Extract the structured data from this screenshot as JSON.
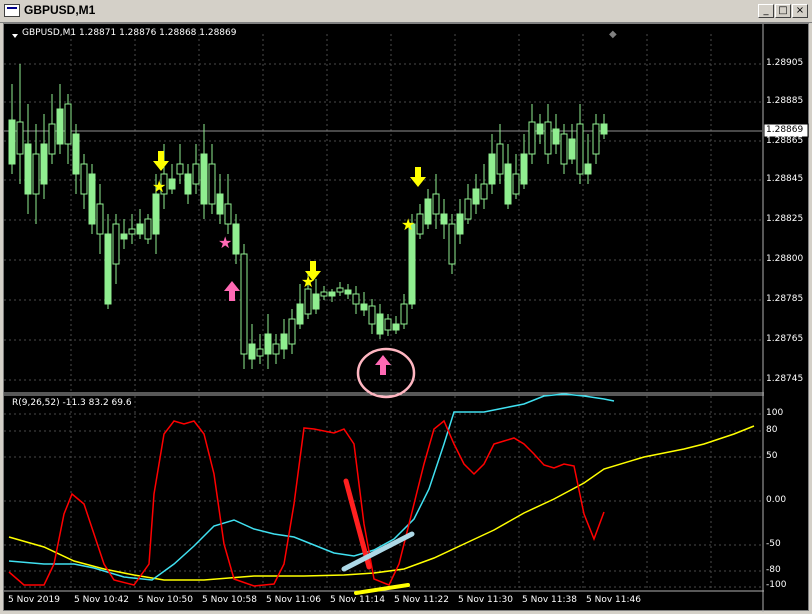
{
  "window": {
    "title": "GBPUSD,M1",
    "buttons": [
      "_",
      "□",
      "×"
    ]
  },
  "chart": {
    "symbol_header": "GBPUSD,M1  1.28871 1.28876 1.28868 1.28869",
    "current_price": "1.28869",
    "price_labels": [
      "1.28905",
      "1.28885",
      "1.28865",
      "1.28845",
      "1.28825",
      "1.28800",
      "1.28785",
      "1.28765",
      "1.28745"
    ],
    "indicator_header": "R(9,26,52) -11.3 83.2 69.6",
    "indicator_levels": [
      "100",
      "80",
      "50",
      "0.00",
      "-50",
      "-80",
      "-100"
    ],
    "time_labels": [
      "5 Nov 2019",
      "5 Nov 10:42",
      "5 Nov 10:50",
      "5 Nov 10:58",
      "5 Nov 11:06",
      "5 Nov 11:14",
      "5 Nov 11:22",
      "5 Nov 11:30",
      "5 Nov 11:38",
      "5 Nov 11:46"
    ],
    "colors": {
      "background": "#000000",
      "grid": "#5a5a5a",
      "candle": "#90ee90",
      "red_line": "#ff0000",
      "cyan_line": "#40e0f0",
      "yellow_line": "#ffff00",
      "arrow_down": "#ffff00",
      "arrow_up": "#ff69b4"
    }
  }
}
